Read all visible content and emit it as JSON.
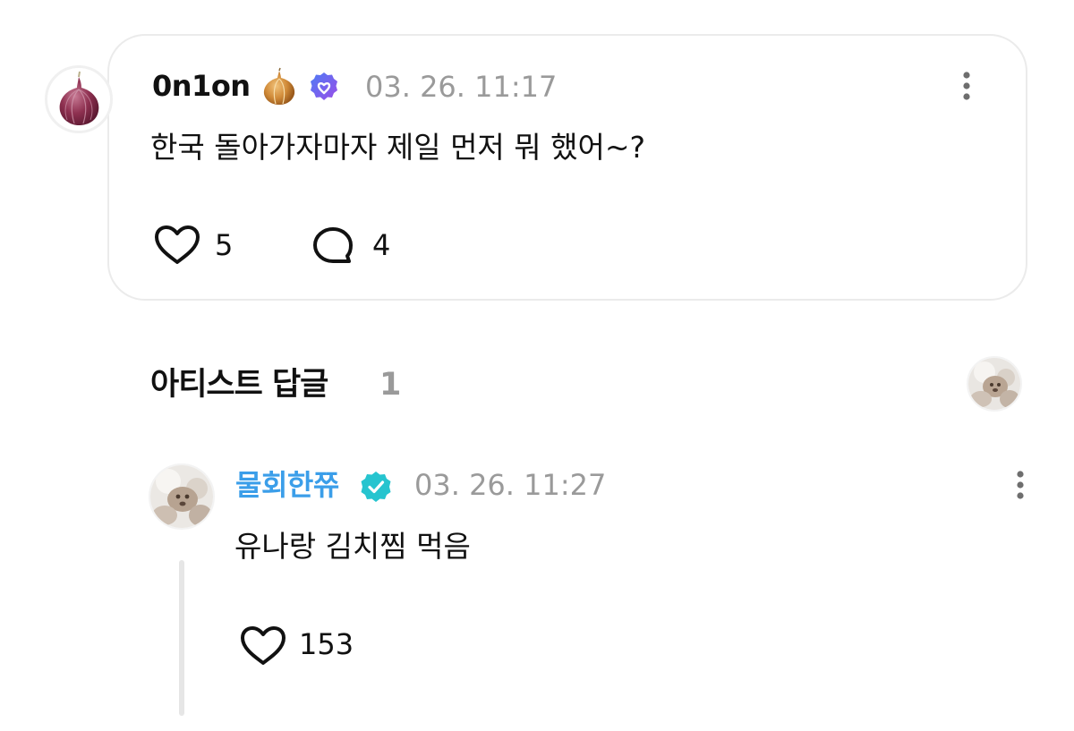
{
  "post": {
    "author": "0n1on",
    "author_emoji": "onion-emoji",
    "badge": "verified-purple-heart-icon",
    "timestamp": "03. 26. 11:17",
    "text": "한국 돌아가자마자 제일 먼저 뭐 했어~?",
    "like_count": "5",
    "comment_count": "4"
  },
  "artist_section": {
    "title": "아티스트 답글",
    "count": "1"
  },
  "reply": {
    "author": "물회한쮸",
    "badge": "verified-teal-check-icon",
    "timestamp": "03. 26. 11:27",
    "text": "유나랑 김치찜 먹음",
    "like_count": "153"
  },
  "colors": {
    "artist_name": "#3b9ee9",
    "timestamp": "#9a9a9a",
    "card_border": "#ebebeb",
    "verified_purple": "#6a5cf0",
    "verified_teal": "#26c4cf"
  }
}
